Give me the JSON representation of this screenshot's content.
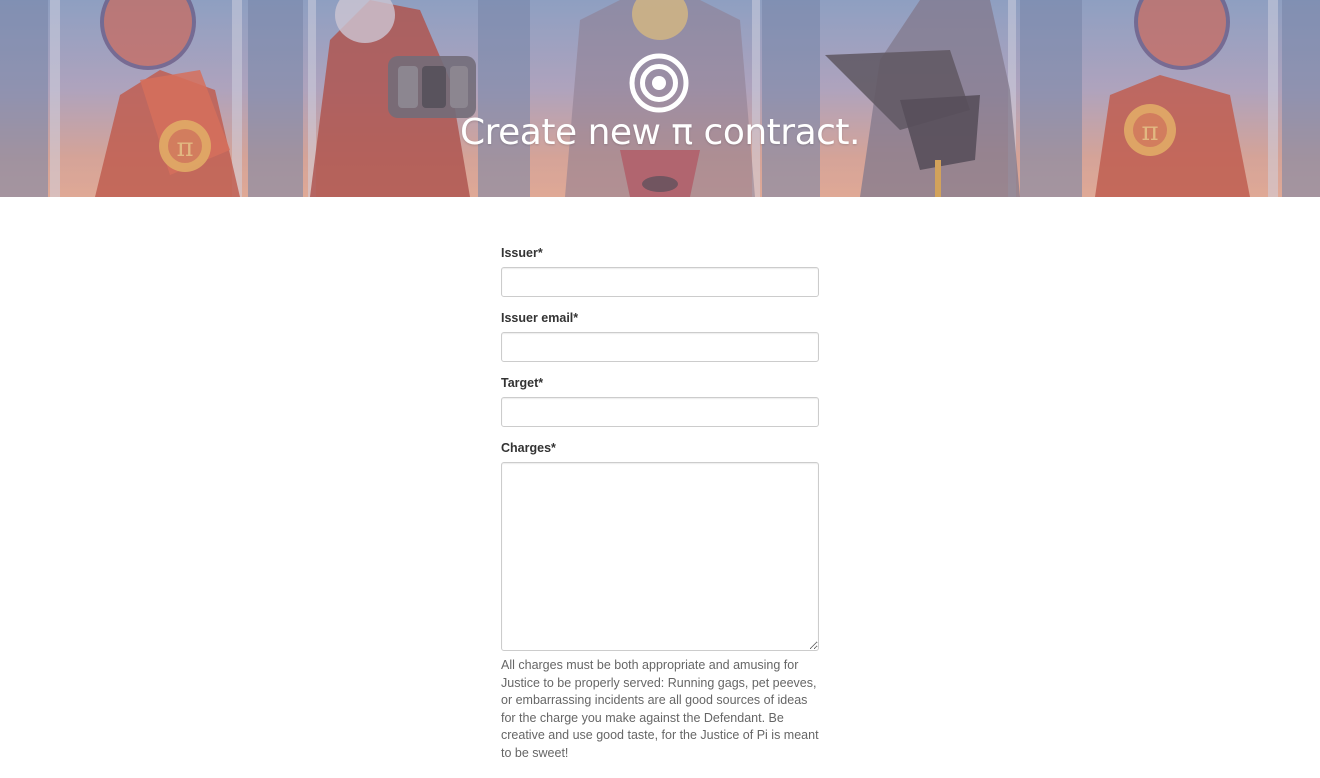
{
  "hero": {
    "title": "Create new π contract.",
    "logo_icon": "concentric-circles-icon",
    "background_colors": [
      "#8da4c9",
      "#e3a996"
    ]
  },
  "form": {
    "fields": [
      {
        "label": "Issuer*",
        "value": "",
        "placeholder": ""
      },
      {
        "label": "Issuer email*",
        "value": "",
        "placeholder": ""
      },
      {
        "label": "Target*",
        "value": "",
        "placeholder": ""
      }
    ],
    "charges": {
      "label": "Charges*",
      "value": "",
      "help": "All charges must be both appropriate and amusing for Justice to be properly served: Running gags, pet peeves, or embarrassing incidents are all good sources of ideas for the charge you make against the Defendant. Be creative and use good taste, for the Justice of Pi is meant to be sweet!"
    }
  }
}
